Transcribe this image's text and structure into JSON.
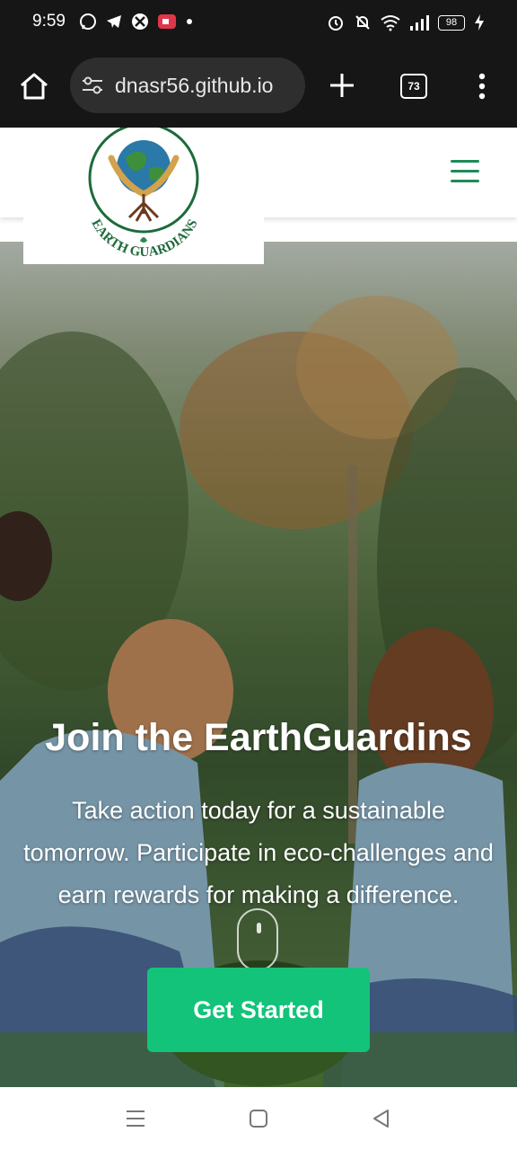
{
  "status_bar": {
    "time": "9:59",
    "battery": "98"
  },
  "browser": {
    "url": "dnasr56.github.io",
    "tab_count": "73"
  },
  "site": {
    "logo_text": "EARTH GUARDIANS"
  },
  "hero": {
    "title": "Join the EarthGuardins",
    "subtitle": "Take action today for a sustainable tomorrow. Participate in eco-challenges and earn rewards for making a difference.",
    "cta_label": "Get Started"
  },
  "colors": {
    "accent": "#13c37a",
    "hamburger": "#1e8a5a"
  }
}
